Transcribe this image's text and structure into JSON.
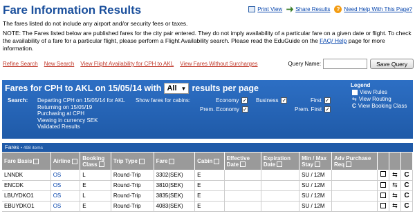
{
  "title": "Fare Information Results",
  "top_links": {
    "print": "Print View",
    "share": "Share Results",
    "help": "Need Help With This Page?"
  },
  "note1": "The fares listed do not include any airport and/or security fees or taxes.",
  "note2": "NOTE: The Fares listed below are published fares for the city pair entered. They do not imply availability of a particular fare on a given date or flight. To check the availability of a fare for a particular flight, please perform a Flight Availability search. Please read the EduGuide on the",
  "note2_link": "FAQ/ Help",
  "note2_end": "page for more information.",
  "actions": {
    "refine": "Refine Search",
    "new": "New Search",
    "availability": "View Flight Availability for CPH to AKL",
    "without": "View Fares Without Surcharges",
    "query_label": "Query Name:",
    "query_value": "",
    "save": "Save Query"
  },
  "header": {
    "prefix": "Fares for CPH to AKL on 15/05/14 with",
    "select_value": "All",
    "suffix": "results per page"
  },
  "search": {
    "label": "Search:",
    "lines": [
      "Departing CPH on 15/05/14 for AKL",
      "Returning on 15/05/19",
      "Purchasing at CPH",
      "Viewing in currency SEK",
      "Validated Results"
    ]
  },
  "cabins": {
    "label": "Show fares for cabins:",
    "economy": "Economy",
    "business": "Business",
    "first": "First",
    "prem_economy": "Prem. Economy",
    "prem_first": "Prem. First",
    "check": "✓"
  },
  "legend": {
    "title": "Legend",
    "rules": "View Rules",
    "routing": "View Routing",
    "booking": "View Booking Class"
  },
  "fares_bar": {
    "label": "Fares",
    "count": "• 498 items"
  },
  "columns": [
    "Fare Basis",
    "Airline",
    "Booking Class",
    "Trip Type",
    "Fare",
    "Cabin",
    "Effective Date",
    "Expiration Date",
    "Min / Max Stay",
    "Adv Purchase Req"
  ],
  "rows": [
    {
      "basis": "LNNDK",
      "airline": "OS",
      "booking": "L",
      "trip": "Round-Trip",
      "fare": "3302(SEK)",
      "cabin": "E",
      "eff": "",
      "exp": "",
      "stay": "SU / 12M",
      "adv": ""
    },
    {
      "basis": "ENCDK",
      "airline": "OS",
      "booking": "E",
      "trip": "Round-Trip",
      "fare": "3810(SEK)",
      "cabin": "E",
      "eff": "",
      "exp": "",
      "stay": "SU / 12M",
      "adv": ""
    },
    {
      "basis": "LBUYDKO1",
      "airline": "OS",
      "booking": "L",
      "trip": "Round-Trip",
      "fare": "3835(SEK)",
      "cabin": "E",
      "eff": "",
      "exp": "",
      "stay": "SU / 12M",
      "adv": ""
    },
    {
      "basis": "EBUYDKO1",
      "airline": "OS",
      "booking": "E",
      "trip": "Round-Trip",
      "fare": "4083(SEK)",
      "cabin": "E",
      "eff": "",
      "exp": "",
      "stay": "SU / 12M",
      "adv": ""
    }
  ],
  "row_icons": {
    "routing": "⇆",
    "booking": "C"
  },
  "colors": {
    "title": "#1a4f9c",
    "bar": "#2d6fc4",
    "header": "#9a9a9a"
  }
}
